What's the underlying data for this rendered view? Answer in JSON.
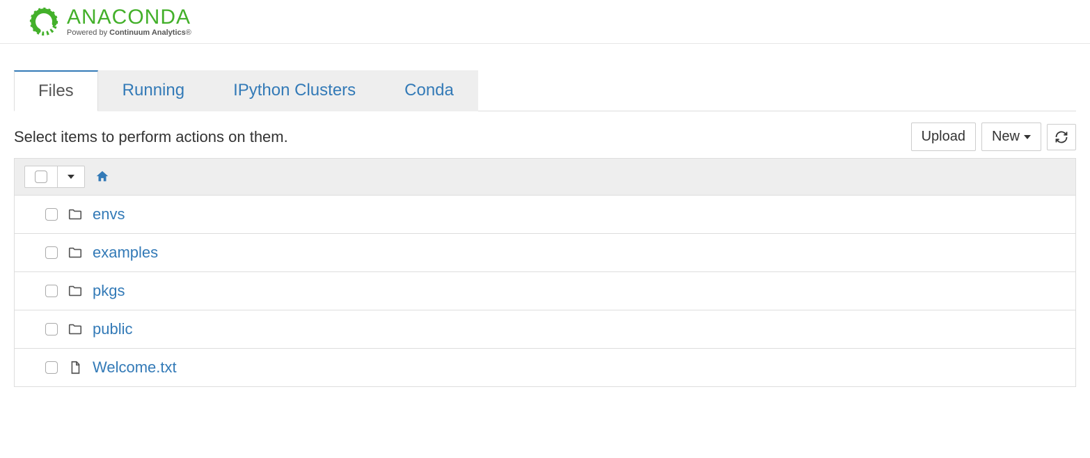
{
  "logo": {
    "brand": "ANACONDA",
    "subline_prefix": "Powered by ",
    "subline_bold": "Continuum Analytics",
    "subline_suffix": "®",
    "color": "#43b02a"
  },
  "tabs": [
    {
      "label": "Files",
      "active": true
    },
    {
      "label": "Running",
      "active": false
    },
    {
      "label": "IPython Clusters",
      "active": false
    },
    {
      "label": "Conda",
      "active": false
    }
  ],
  "toolbar": {
    "hint": "Select items to perform actions on them.",
    "upload_label": "Upload",
    "new_label": "New",
    "refresh_icon": "refresh-icon"
  },
  "breadcrumb": {
    "home_icon": "home-icon"
  },
  "items": [
    {
      "type": "folder",
      "name": "envs"
    },
    {
      "type": "folder",
      "name": "examples"
    },
    {
      "type": "folder",
      "name": "pkgs"
    },
    {
      "type": "folder",
      "name": "public"
    },
    {
      "type": "file",
      "name": "Welcome.txt"
    }
  ]
}
